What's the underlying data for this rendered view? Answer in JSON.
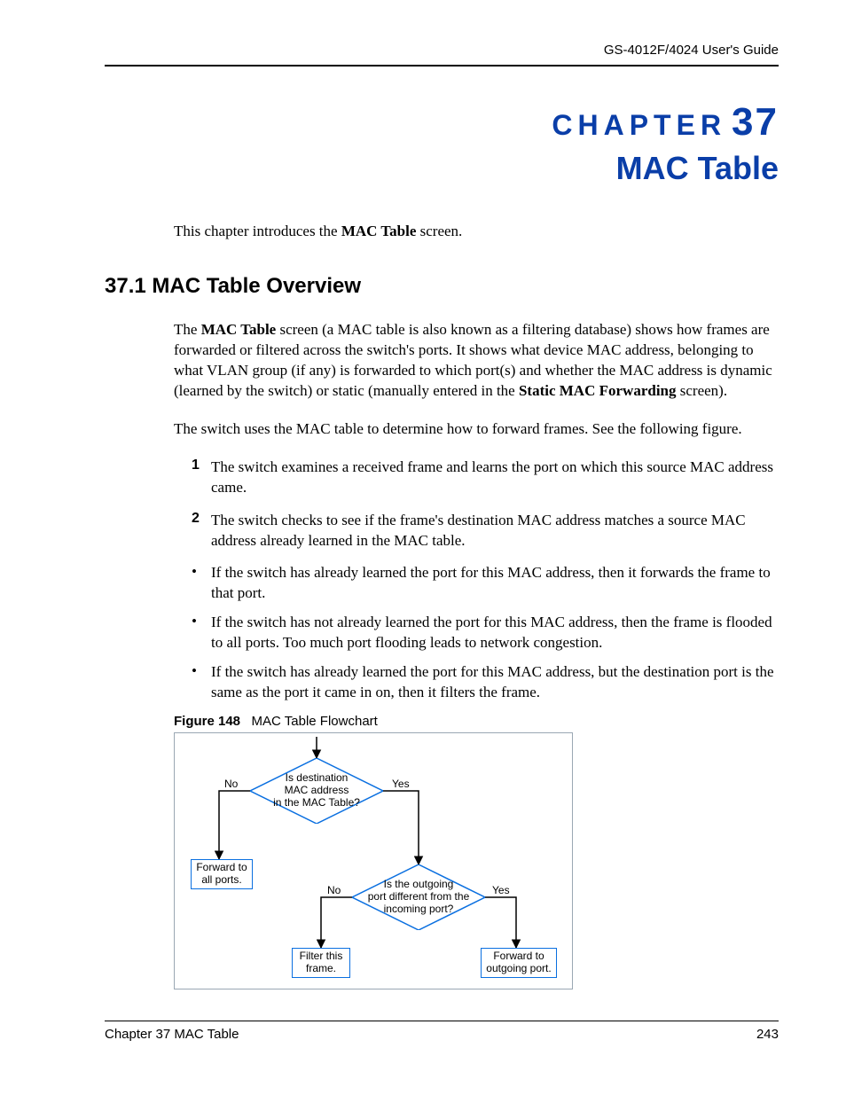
{
  "header": {
    "running": "GS-4012F/4024 User's Guide"
  },
  "chapter": {
    "label": "CHAPTER",
    "number": "37",
    "title": "MAC Table"
  },
  "intro": {
    "prefix": "This chapter introduces the ",
    "bold": "MAC Table",
    "suffix": " screen."
  },
  "section": {
    "heading": "37.1  MAC Table Overview"
  },
  "para1": {
    "seg1": "The ",
    "bold1": "MAC Table",
    "seg2": " screen (a MAC table is also known as a filtering database) shows how frames are forwarded or filtered across the switch's ports. It shows what device MAC address, belonging to what VLAN group (if any) is forwarded to which port(s) and whether the MAC address is dynamic (learned by the switch) or static (manually entered in the ",
    "bold2": "Static MAC Forwarding",
    "seg3": " screen)."
  },
  "para2": "The switch uses the MAC table to determine how to forward frames. See the following figure.",
  "numbered": [
    {
      "n": "1",
      "text": "The switch examines a received frame and learns the port on which this source MAC address came."
    },
    {
      "n": "2",
      "text": "The switch checks to see if the frame's destination MAC address matches a source MAC address already learned in the MAC table."
    }
  ],
  "bullets": [
    "If the switch has already learned the port for this MAC address, then it forwards the frame to that port.",
    "If the switch has not already learned the port for this MAC address, then the frame is flooded to all ports. Too much port flooding leads to network congestion.",
    "If the switch has already learned the port for this MAC address, but the destination port is the same as the port it came in on, then it filters the frame."
  ],
  "figure": {
    "label": "Figure 148",
    "caption": "MAC Table Flowchart",
    "flowchart": {
      "diamond1": "Is destination\nMAC address\nin the MAC Table?",
      "diamond2": "Is the outgoing\nport different from the\nincoming port?",
      "no": "No",
      "yes": "Yes",
      "box_forward_all": "Forward to\nall ports.",
      "box_filter": "Filter this\nframe.",
      "box_forward_out": "Forward to\noutgoing port."
    }
  },
  "footer": {
    "left": "Chapter 37 MAC Table",
    "right": "243"
  },
  "chart_data": {
    "type": "flowchart",
    "nodes": [
      {
        "id": "start",
        "type": "start"
      },
      {
        "id": "d1",
        "type": "decision",
        "text": "Is destination MAC address in the MAC Table?"
      },
      {
        "id": "b_all",
        "type": "process",
        "text": "Forward to all ports."
      },
      {
        "id": "d2",
        "type": "decision",
        "text": "Is the outgoing port different from the incoming port?"
      },
      {
        "id": "b_filter",
        "type": "process",
        "text": "Filter this frame."
      },
      {
        "id": "b_out",
        "type": "process",
        "text": "Forward to outgoing port."
      }
    ],
    "edges": [
      {
        "from": "start",
        "to": "d1"
      },
      {
        "from": "d1",
        "to": "b_all",
        "label": "No"
      },
      {
        "from": "d1",
        "to": "d2",
        "label": "Yes"
      },
      {
        "from": "d2",
        "to": "b_filter",
        "label": "No"
      },
      {
        "from": "d2",
        "to": "b_out",
        "label": "Yes"
      }
    ]
  }
}
